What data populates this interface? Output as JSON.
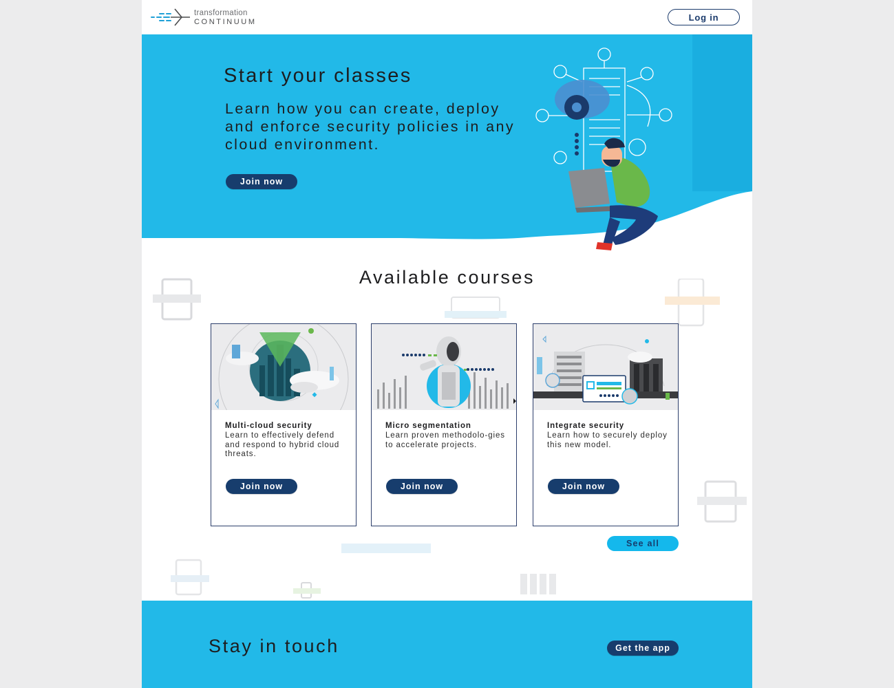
{
  "colors": {
    "brand_blue": "#22b9e8",
    "navy": "#173d6d",
    "bright_blue": "#14b8ec",
    "background": "#ececed"
  },
  "header": {
    "logo_line1": "transformation",
    "logo_line2": "CONTINUUM",
    "login_label": "Log in"
  },
  "hero": {
    "title": "Start your classes",
    "text": "Learn how you can create, deploy and enforce security policies in any cloud environment.",
    "cta_label": "Join now",
    "illustration_icon": "person-with-laptop-cloud-network-illustration"
  },
  "courses": {
    "title": "Available courses",
    "items": [
      {
        "title": "Multi-cloud security",
        "description": "Learn to effectively defend and respond to hybrid cloud threats.",
        "cta_label": "Join now",
        "image_icon": "city-globe-clouds-image"
      },
      {
        "title": "Micro segmentation",
        "description": "Learn proven methodolo-gies to accelerate projects.",
        "cta_label": "Join now",
        "image_icon": "robot-image"
      },
      {
        "title": "Integrate security",
        "description": "Learn how to securely deploy this new model.",
        "cta_label": "Join now",
        "image_icon": "buildings-dashboard-image"
      }
    ],
    "see_all_label": "See all"
  },
  "footer": {
    "title": "Stay in touch",
    "cta_label": "Get the app"
  }
}
